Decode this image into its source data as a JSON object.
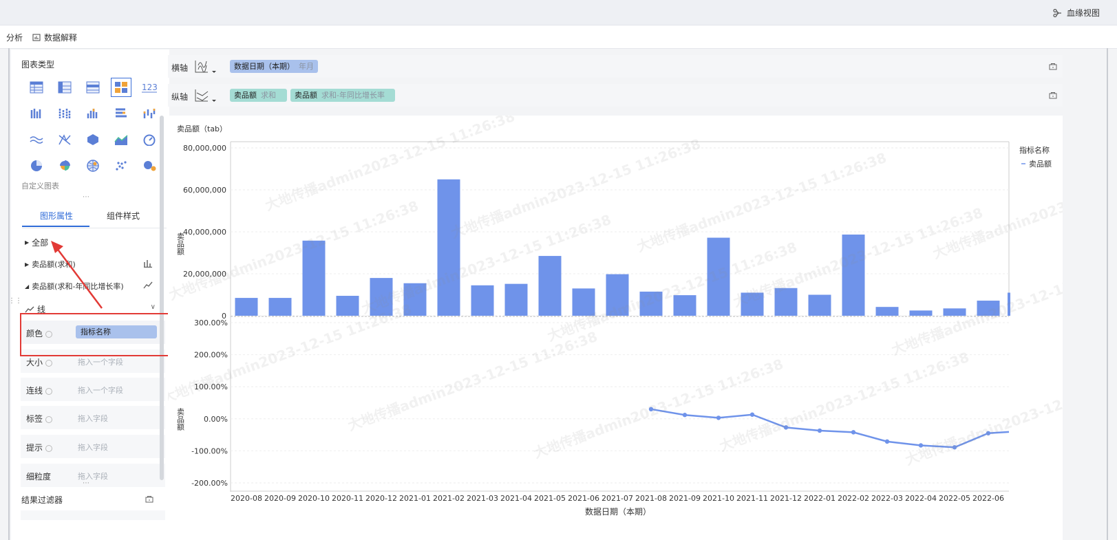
{
  "topbar": {
    "lineage_label": "血缘视图"
  },
  "subbar": {
    "analysis_label": "分析",
    "explain_label": "数据解释"
  },
  "left_panel": {
    "chart_types_label": "图表类型",
    "custom_chart_label": "自定义图表",
    "tabs": [
      "图形属性",
      "组件样式"
    ],
    "props": {
      "all": "全部",
      "sales_sum": "卖品额(求和)",
      "sales_yoy": "卖品额(求和-年同比增长率)",
      "line": "线"
    },
    "fields": [
      {
        "label": "颜色",
        "value": "指标名称"
      },
      {
        "label": "大小",
        "placeholder": "拖入一个字段"
      },
      {
        "label": "连线",
        "placeholder": "拖入一个字段"
      },
      {
        "label": "标签",
        "placeholder": "拖入字段"
      },
      {
        "label": "提示",
        "placeholder": "拖入字段"
      },
      {
        "label": "细粒度",
        "placeholder": "拖入字段"
      }
    ],
    "result_filter_label": "结果过滤器"
  },
  "axes": {
    "x_label": "横轴",
    "y_label": "纵轴",
    "x_field": {
      "name": "数据日期（本期）",
      "agg": "年月"
    },
    "y_fields": [
      {
        "name": "卖品额",
        "agg": "求和"
      },
      {
        "name": "卖品额",
        "agg": "求和-年同比增长率"
      }
    ]
  },
  "watermark": "大地传播admin2023-12-15 11:26:38",
  "chart_data": {
    "type": "bar",
    "title": "卖品额（tab）",
    "xlabel": "数据日期（本期）",
    "ylabel": "卖品额",
    "legend": {
      "title": "指标名称",
      "items": [
        "卖品额"
      ],
      "position": "right"
    },
    "categories": [
      "2020-08",
      "2020-09",
      "2020-10",
      "2020-11",
      "2020-12",
      "2021-01",
      "2021-02",
      "2021-03",
      "2021-04",
      "2021-05",
      "2021-06",
      "2021-07",
      "2021-08",
      "2021-09",
      "2021-10",
      "2021-11",
      "2021-12",
      "2022-01",
      "2022-02",
      "2022-03",
      "2022-04",
      "2022-05",
      "2022-06"
    ],
    "bar_series": {
      "ylim": [
        0,
        80000000
      ],
      "yticks": [
        "80,000,000",
        "60,000,000",
        "40,000,000",
        "20,000,000",
        "0"
      ],
      "values": [
        8500000,
        8500000,
        35800000,
        9500000,
        18000000,
        15500000,
        65000000,
        14500000,
        15200000,
        28500000,
        13000000,
        19800000,
        11500000,
        9800000,
        37200000,
        11000000,
        13200000,
        10000000,
        38700000,
        4200000,
        2500000,
        3500000,
        7200000
      ]
    },
    "line_series": {
      "ylim": [
        -200,
        300
      ],
      "yticks": [
        "300.00%",
        "200.00%",
        "100.00%",
        "0.00%",
        "-100.00%",
        "-200.00%"
      ],
      "values": [
        null,
        null,
        null,
        null,
        null,
        null,
        null,
        null,
        null,
        null,
        null,
        null,
        30,
        12,
        3,
        13,
        -27,
        -37,
        -42,
        -71,
        -83,
        -89,
        -45
      ],
      "tail_value": -41
    },
    "color": "#6f93ea"
  }
}
